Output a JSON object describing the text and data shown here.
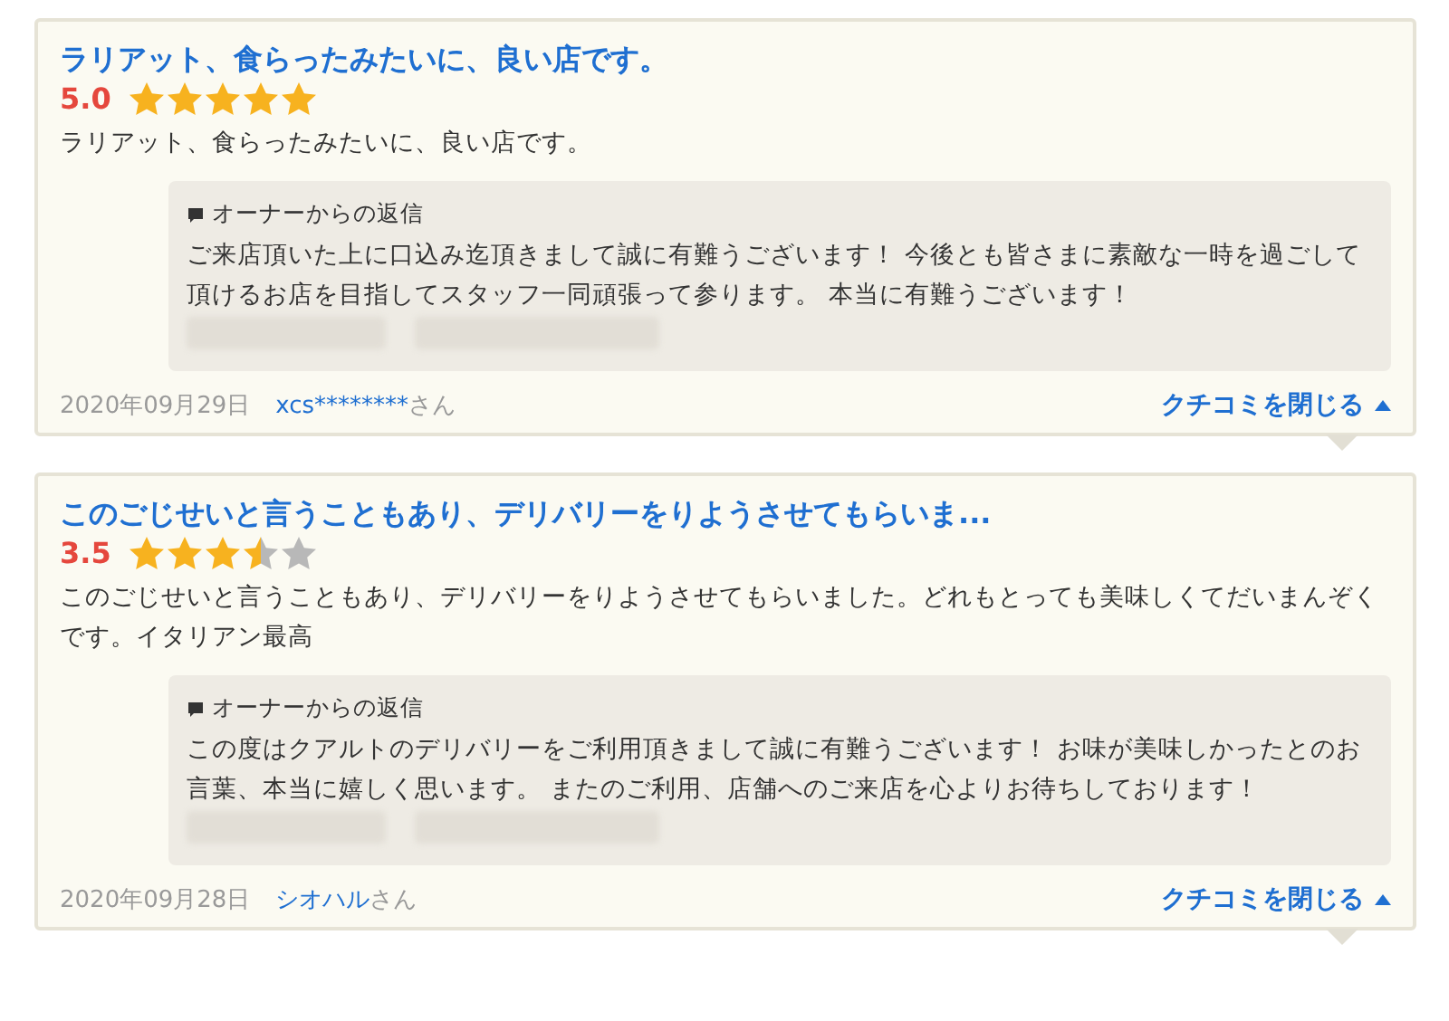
{
  "reviews": [
    {
      "title": "ラリアット、食らったみたいに、良い店です。",
      "rating": "5.0",
      "stars": 5,
      "body": "ラリアット、食らったみたいに、良い店です。",
      "reply": {
        "heading": "オーナーからの返信",
        "text": "ご来店頂いた上に口込み迄頂きまして誠に有難うございます！ 今後とも皆さまに素敵な一時を過ごして頂けるお店を目指してスタッフ一同頑張って参ります。 本当に有難うございます！"
      },
      "date": "2020年09月29日",
      "user": "xcs********",
      "honorific": "さん",
      "toggle": "クチコミを閉じる"
    },
    {
      "title": "このごじせいと言うこともあり、デリバリーをりようさせてもらいま...",
      "rating": "3.5",
      "stars": 3.5,
      "body": "このごじせいと言うこともあり、デリバリーをりようさせてもらいました。どれもとっても美味しくてだいまんぞくです。イタリアン最高",
      "reply": {
        "heading": "オーナーからの返信",
        "text": "この度はクアルトのデリバリーをご利用頂きまして誠に有難うございます！ お味が美味しかったとのお言葉、本当に嬉しく思います。 またのご利用、店舗へのご来店を心よりお待ちしております！"
      },
      "date": "2020年09月28日",
      "user": "シオハル",
      "honorific": "さん",
      "toggle": "クチコミを閉じる"
    }
  ]
}
